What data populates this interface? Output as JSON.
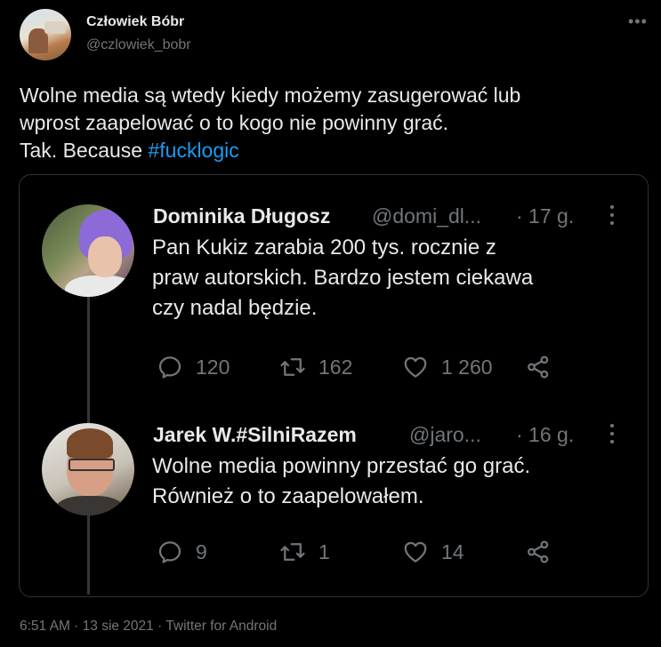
{
  "tweet": {
    "author_name": "Człowiek Bóbr",
    "author_handle": "@czlowiek_bobr",
    "more_menu_icon": "more-horizontal-icon",
    "text_line1": "Wolne media są wtedy kiedy możemy zasugerować lub",
    "text_line2": "wprost zaapelować o to kogo nie powinny grać.",
    "text_line3": "Tak. Because ",
    "hashtag": "#fucklogic",
    "hashtag_color": "#1d9bf0",
    "footer": "6:51 AM · 13 sie 2021 · Twitter for Android"
  },
  "quoted_thread": [
    {
      "name": "Dominika Długosz",
      "handle": "@domi_dl...",
      "time": "· 17 g.",
      "text_lines": [
        "Pan Kukiz zarabia 200 tys. rocznie z",
        "praw autorskich. Bardzo jestem ciekawa",
        "czy nadal będzie."
      ],
      "replies": "120",
      "retweets": "162",
      "likes": "1 260"
    },
    {
      "name": "Jarek W.#SilniRazem",
      "handle": "@jaro...",
      "time": "· 16 g.",
      "text_lines": [
        "Wolne media powinny przestać go grać.",
        "Również o to zaapelowałem."
      ],
      "replies": "9",
      "retweets": "1",
      "likes": "14"
    }
  ],
  "icons": {
    "reply": "reply-icon",
    "retweet": "retweet-icon",
    "like": "heart-icon",
    "share": "share-icon",
    "menu": "more-vertical-icon"
  },
  "colors": {
    "background": "#000000",
    "text_primary": "#e7e9ea",
    "text_secondary": "#71767b",
    "border": "#2f3336"
  }
}
